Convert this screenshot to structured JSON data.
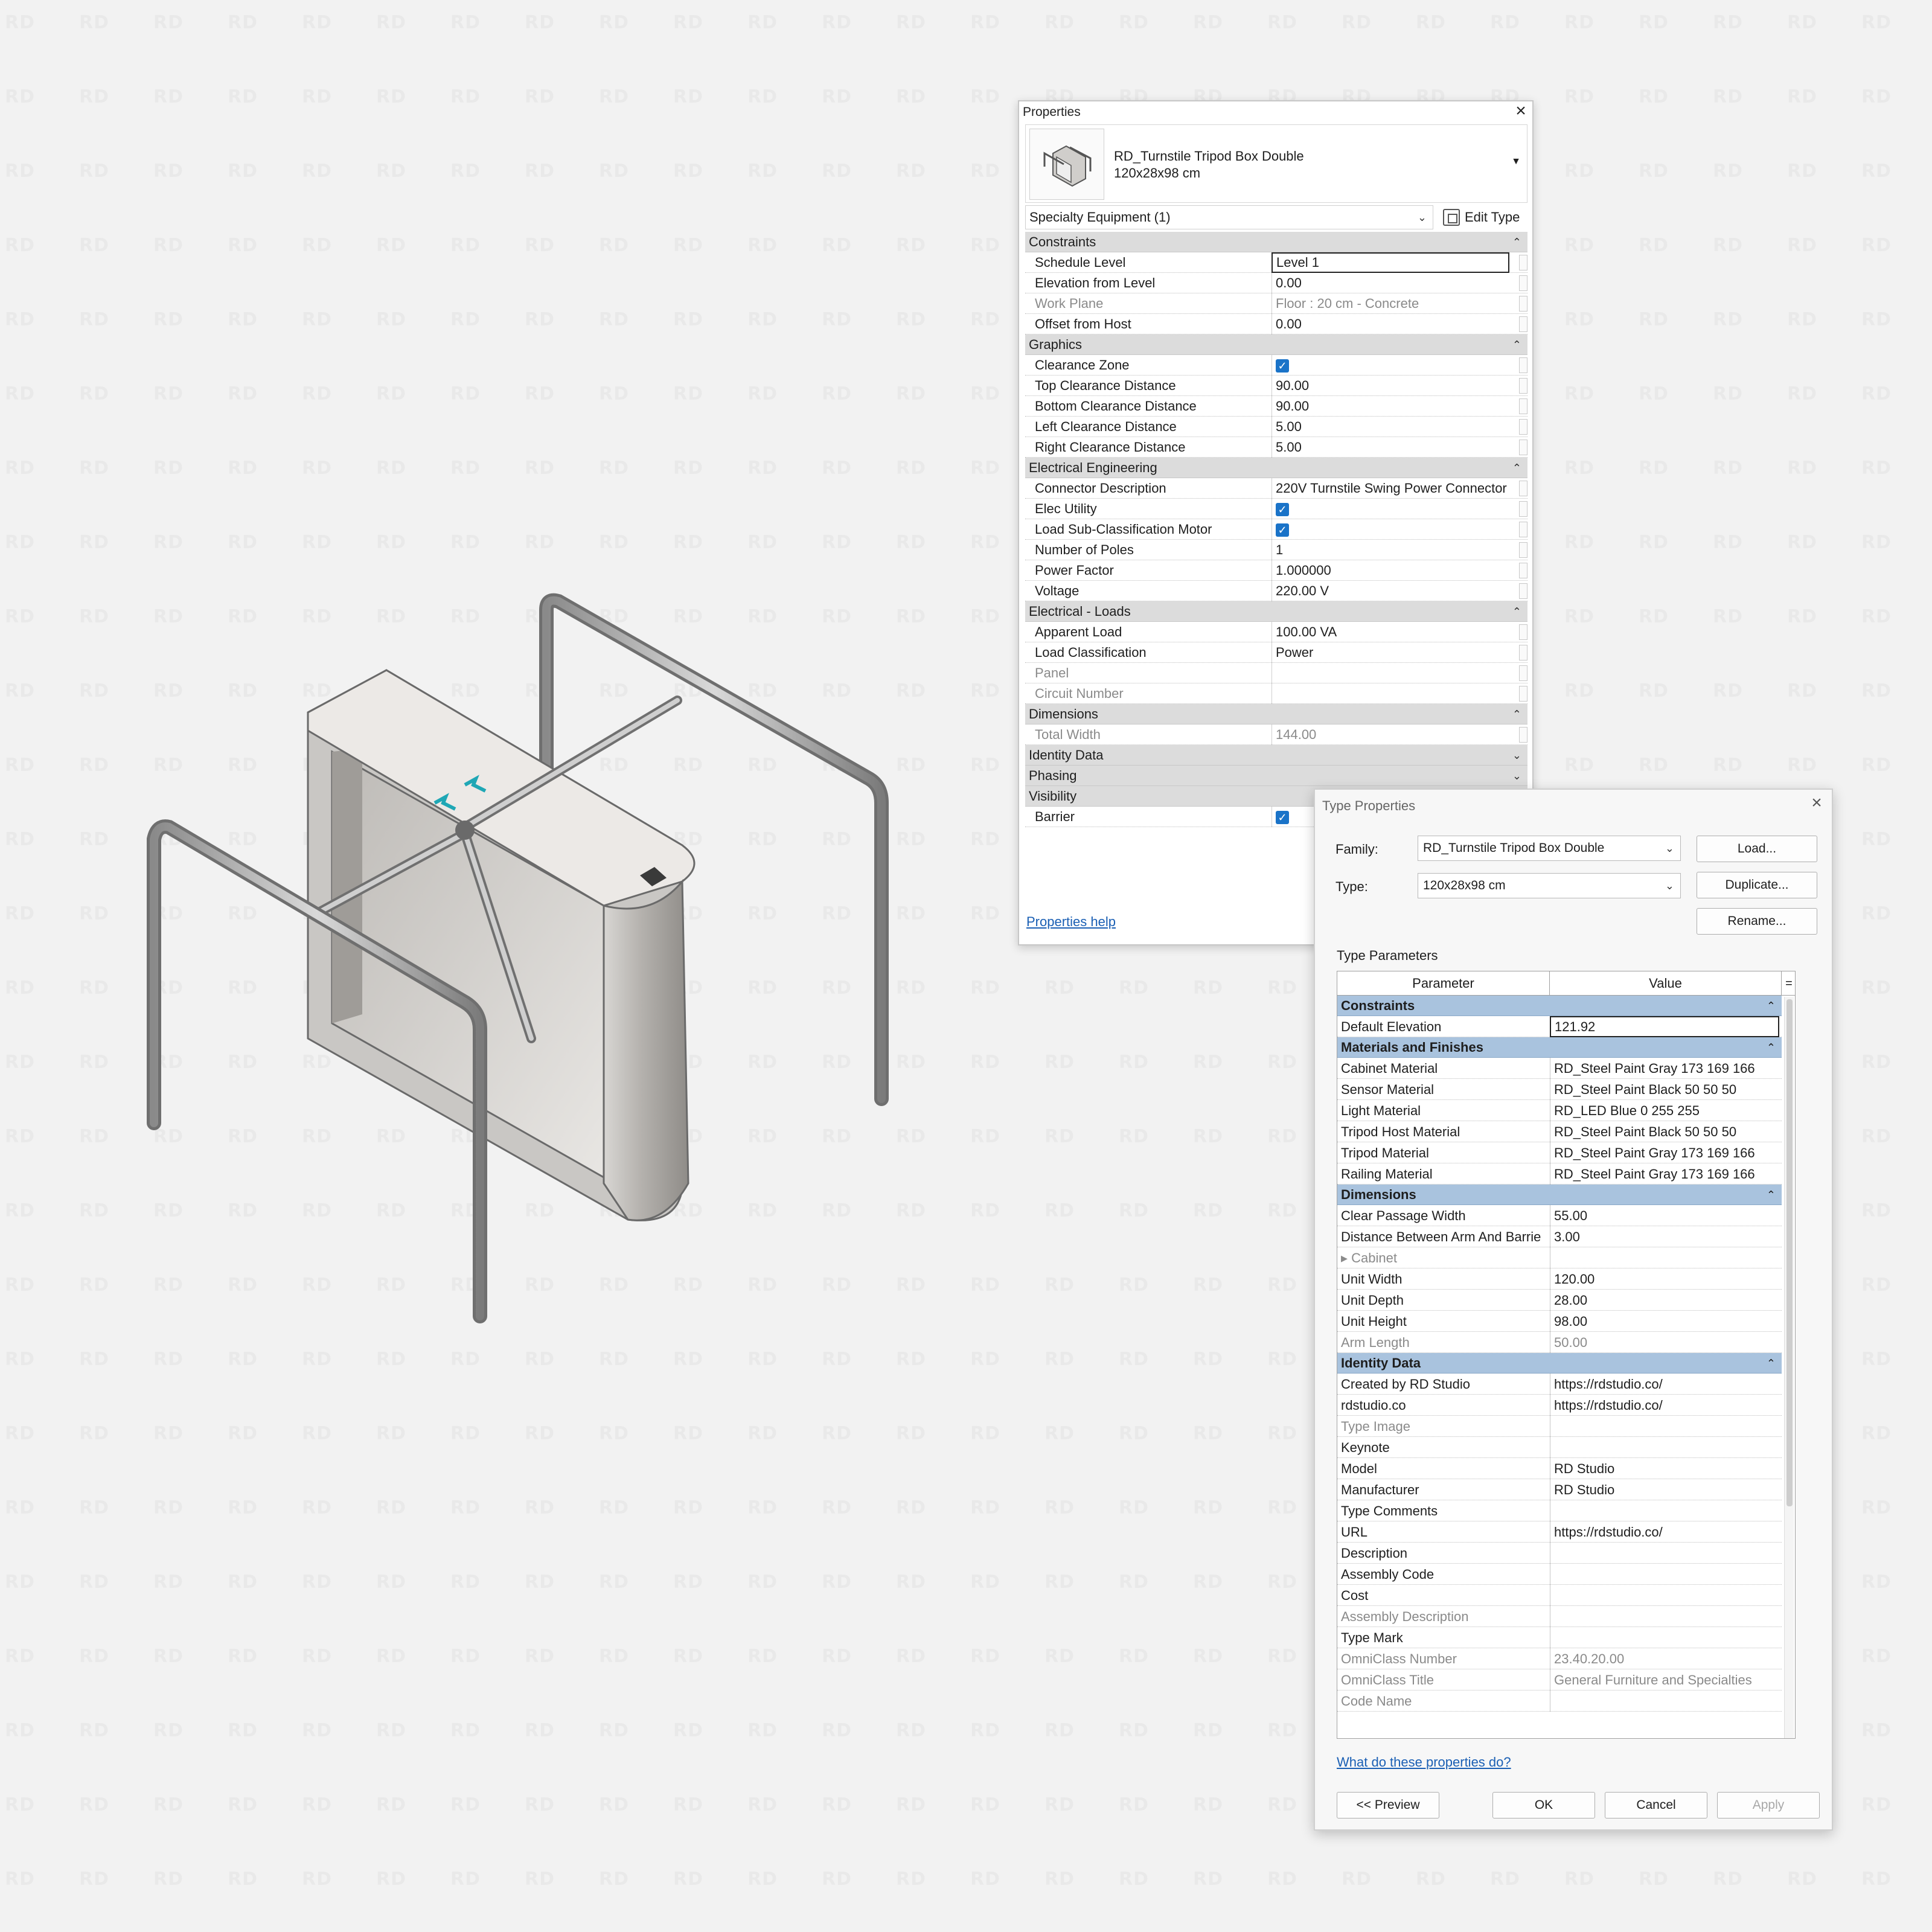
{
  "watermark_text": "RD",
  "properties": {
    "title": "Properties",
    "type_name": "RD_Turnstile Tripod Box Double",
    "type_size": "120x28x98 cm",
    "category": "Specialty Equipment (1)",
    "edit_type": "Edit Type",
    "groups": [
      {
        "name": "Constraints",
        "toggle": "⌃",
        "rows": [
          {
            "k": "Schedule Level",
            "v": "Level 1"
          },
          {
            "k": "Elevation from Level",
            "v": "0.00"
          },
          {
            "k": "Work Plane",
            "v": "Floor : 20 cm - Concrete"
          },
          {
            "k": "Offset from Host",
            "v": "0.00"
          }
        ]
      },
      {
        "name": "Graphics",
        "toggle": "⌃",
        "rows": [
          {
            "k": "Clearance Zone",
            "v": ""
          },
          {
            "k": "Top Clearance Distance",
            "v": "90.00"
          },
          {
            "k": "Bottom Clearance Distance",
            "v": "90.00"
          },
          {
            "k": "Left Clearance Distance",
            "v": "5.00"
          },
          {
            "k": "Right Clearance Distance",
            "v": "5.00"
          }
        ]
      },
      {
        "name": "Electrical Engineering",
        "toggle": "⌃",
        "rows": [
          {
            "k": "Connector Description",
            "v": "220V Turnstile Swing Power Connector"
          },
          {
            "k": "Elec Utility",
            "v": ""
          },
          {
            "k": "Load Sub-Classification Motor",
            "v": ""
          },
          {
            "k": "Number of Poles",
            "v": "1"
          },
          {
            "k": "Power Factor",
            "v": "1.000000"
          },
          {
            "k": "Voltage",
            "v": "220.00 V"
          }
        ]
      },
      {
        "name": "Electrical - Loads",
        "toggle": "⌃",
        "rows": [
          {
            "k": "Apparent Load",
            "v": "100.00 VA"
          },
          {
            "k": "Load Classification",
            "v": "Power"
          },
          {
            "k": "Panel",
            "v": ""
          },
          {
            "k": "Circuit Number",
            "v": ""
          }
        ]
      },
      {
        "name": "Dimensions",
        "toggle": "⌃",
        "rows": [
          {
            "k": "Total Width",
            "v": "144.00"
          }
        ]
      },
      {
        "name": "Identity Data",
        "toggle": "⌄",
        "rows": []
      },
      {
        "name": "Phasing",
        "toggle": "⌄",
        "rows": []
      },
      {
        "name": "Visibility",
        "toggle": "",
        "rows": [
          {
            "k": "Barrier",
            "v": ""
          }
        ]
      }
    ],
    "help_link": "Properties help"
  },
  "type_props": {
    "title": "Type Properties",
    "family_label": "Family:",
    "family_value": "RD_Turnstile Tripod Box Double",
    "type_label": "Type:",
    "type_value": "120x28x98 cm",
    "load_btn": "Load...",
    "duplicate_btn": "Duplicate...",
    "rename_btn": "Rename...",
    "params_label": "Type Parameters",
    "col_param": "Parameter",
    "col_value": "Value",
    "col_eq": "=",
    "groups": [
      {
        "name": "Constraints",
        "rows": [
          {
            "k": "Default Elevation",
            "v": "121.92"
          }
        ]
      },
      {
        "name": "Materials and Finishes",
        "rows": [
          {
            "k": "Cabinet Material",
            "v": "RD_Steel Paint Gray 173 169 166"
          },
          {
            "k": "Sensor Material",
            "v": "RD_Steel Paint Black 50 50 50"
          },
          {
            "k": "Light Material",
            "v": "RD_LED Blue 0 255 255"
          },
          {
            "k": "Tripod Host Material",
            "v": "RD_Steel Paint Black 50 50 50"
          },
          {
            "k": "Tripod Material",
            "v": "RD_Steel Paint Gray 173 169 166"
          },
          {
            "k": "Railing Material",
            "v": "RD_Steel Paint Gray 173 169 166"
          }
        ]
      },
      {
        "name": "Dimensions",
        "rows": [
          {
            "k": "Clear Passage Width",
            "v": "55.00"
          },
          {
            "k": "Distance Between Arm And Barrie",
            "v": "3.00"
          },
          {
            "k": "▸ Cabinet",
            "v": ""
          },
          {
            "k": "Unit Width",
            "v": "120.00"
          },
          {
            "k": "Unit Depth",
            "v": "28.00"
          },
          {
            "k": "Unit Height",
            "v": "98.00"
          },
          {
            "k": "Arm Length",
            "v": "50.00"
          }
        ]
      },
      {
        "name": "Identity Data",
        "rows": [
          {
            "k": "Created by RD Studio",
            "v": "https://rdstudio.co/"
          },
          {
            "k": "rdstudio.co",
            "v": "https://rdstudio.co/"
          },
          {
            "k": "Type Image",
            "v": ""
          },
          {
            "k": "Keynote",
            "v": ""
          },
          {
            "k": "Model",
            "v": "RD Studio"
          },
          {
            "k": "Manufacturer",
            "v": "RD Studio"
          },
          {
            "k": "Type Comments",
            "v": ""
          },
          {
            "k": "URL",
            "v": "https://rdstudio.co/"
          },
          {
            "k": "Description",
            "v": ""
          },
          {
            "k": "Assembly Code",
            "v": ""
          },
          {
            "k": "Cost",
            "v": ""
          },
          {
            "k": "Assembly Description",
            "v": ""
          },
          {
            "k": "Type Mark",
            "v": ""
          },
          {
            "k": "OmniClass Number",
            "v": "23.40.20.00"
          },
          {
            "k": "OmniClass Title",
            "v": "General Furniture and Specialties"
          },
          {
            "k": "Code Name",
            "v": ""
          }
        ]
      }
    ],
    "help_link": "What do these properties do?",
    "preview_btn": "<< Preview",
    "ok_btn": "OK",
    "cancel_btn": "Cancel",
    "apply_btn": "Apply"
  }
}
